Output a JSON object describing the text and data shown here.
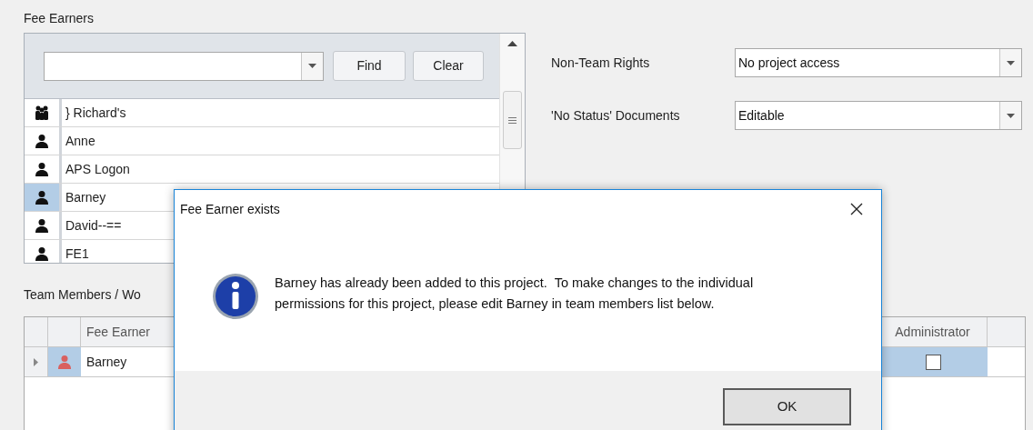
{
  "fee_earners": {
    "title": "Fee Earners",
    "find_button": "Find",
    "clear_button": "Clear",
    "items": [
      {
        "name": "} Richard's",
        "kind": "group",
        "selected": false
      },
      {
        "name": "Anne",
        "kind": "person",
        "selected": false
      },
      {
        "name": "APS Logon",
        "kind": "person",
        "selected": false
      },
      {
        "name": "Barney",
        "kind": "person",
        "selected": true
      },
      {
        "name": "David--==",
        "kind": "person",
        "selected": false
      },
      {
        "name": "FE1",
        "kind": "person",
        "selected": false
      }
    ]
  },
  "settings": [
    {
      "label": "Non-Team Rights",
      "value": "No project access"
    },
    {
      "label": "'No Status' Documents",
      "value": "Editable"
    }
  ],
  "team_members": {
    "title": "Team Members / Wo",
    "columns": [
      "Fee Earner",
      "Administrator"
    ],
    "rows": [
      {
        "fee_earner": "Barney",
        "administrator": false,
        "selected": true
      }
    ]
  },
  "dialog": {
    "title": "Fee Earner exists",
    "message": "Barney has already been added to this project.  To make changes to the individual permissions for this project, please edit Barney in team members list below.",
    "button": "OK"
  }
}
